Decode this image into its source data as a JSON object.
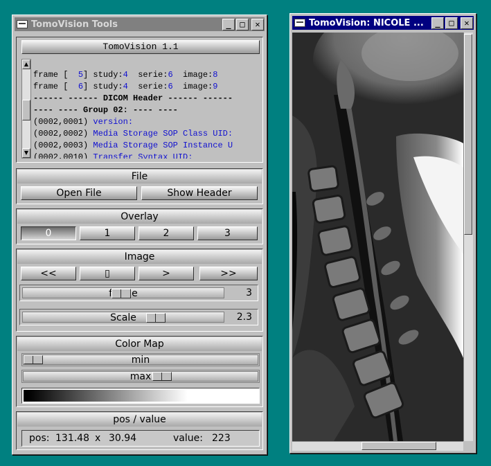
{
  "tools_window": {
    "title": "TomoVision Tools",
    "version_label": "TomoVision 1.1",
    "header_lines": [
      {
        "a": "frame [  ",
        "b": "5",
        "c": "] study:",
        "d": "4",
        "e": "  serie:",
        "f": "6",
        "g": "  image:",
        "h": "8"
      },
      {
        "a": "frame [  ",
        "b": "6",
        "c": "] study:",
        "d": "4",
        "e": "  serie:",
        "f": "6",
        "g": "  image:",
        "h": "9"
      }
    ],
    "dicom_header_line": "------ ------ DICOM Header ------ ------",
    "group_line": "---- ---- Group 02: ---- ----",
    "tags": [
      {
        "code": "(0002,0001)",
        "name": "version:"
      },
      {
        "code": "(0002,0002)",
        "name": "Media Storage SOP Class UID:"
      },
      {
        "code": "(0002,0003)",
        "name": "Media Storage SOP Instance U"
      },
      {
        "code": "(0002,0010)",
        "name": "Transfer Syntax UID:"
      }
    ],
    "file_section": {
      "title": "File",
      "open_label": "Open File",
      "show_label": "Show Header"
    },
    "overlay_section": {
      "title": "Overlay",
      "buttons": [
        "0",
        "1",
        "2",
        "3"
      ],
      "selected": "0"
    },
    "image_section": {
      "title": "Image",
      "buttons": [
        "<<",
        "▯",
        ">",
        ">>"
      ],
      "frame_label": "frame",
      "frame_value": "3",
      "scale_label": "Scale",
      "scale_value": "2.3"
    },
    "colormap_section": {
      "title": "Color Map",
      "min_label": "min",
      "max_label": "max"
    },
    "posvalue_section": {
      "title": "pos / value",
      "pos_label": "pos:",
      "pos_x": "131.48",
      "pos_sep": "x",
      "pos_y": "30.94",
      "value_label": "value:",
      "value": "223"
    }
  },
  "viewer_window": {
    "title": "TomoVision: NICOLE  ..."
  },
  "colors": {
    "desktop": "#008080",
    "active_title": "#000080",
    "inactive_title": "#808080",
    "link_blue": "#1010d0"
  }
}
